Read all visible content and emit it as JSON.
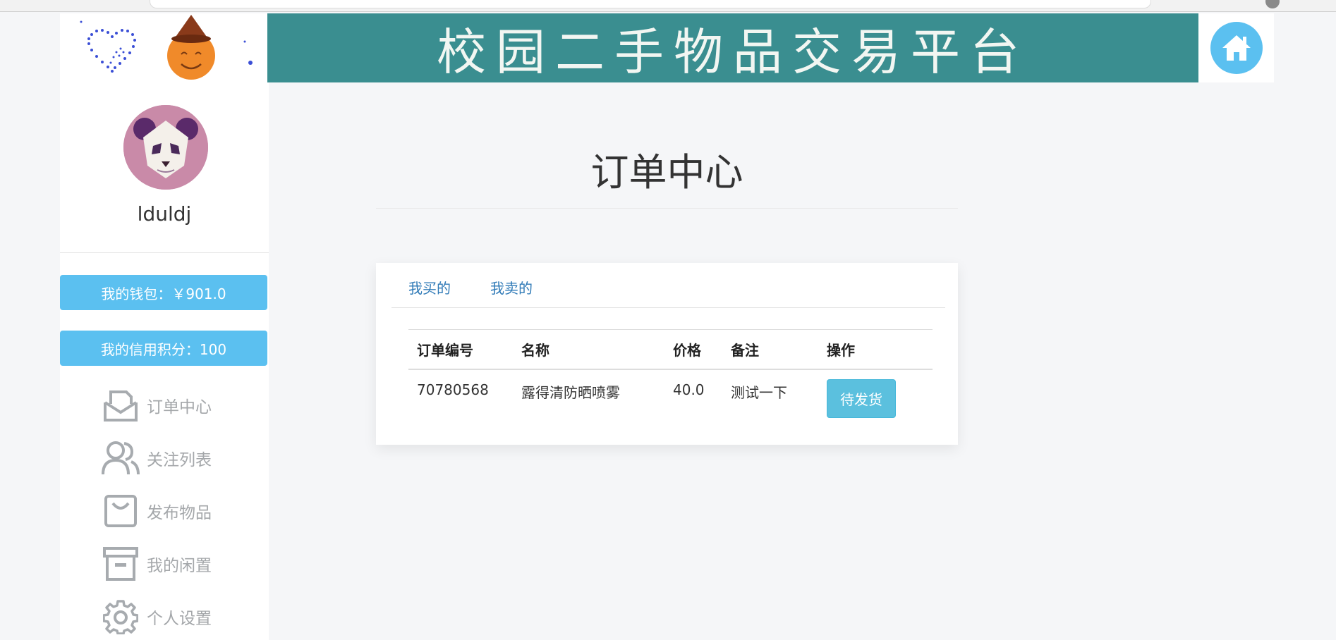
{
  "header": {
    "banner_title": "校园二手物品交易平台",
    "home_icon": "home-icon",
    "accent": "#3a8e90"
  },
  "sidebar": {
    "username": "lduldj",
    "wallet_label": "我的钱包：￥901.0",
    "credit_label": "我的信用积分：100",
    "items": [
      {
        "label": "订单中心",
        "icon": "mail-open-icon"
      },
      {
        "label": "关注列表",
        "icon": "users-icon"
      },
      {
        "label": "发布物品",
        "icon": "shopping-bag-icon"
      },
      {
        "label": "我的闲置",
        "icon": "archive-box-icon"
      },
      {
        "label": "个人设置",
        "icon": "gear-icon"
      }
    ],
    "pill_color": "#5bc0f0"
  },
  "main": {
    "title": "订单中心",
    "tabs": [
      {
        "label": "我买的"
      },
      {
        "label": "我卖的"
      }
    ],
    "table": {
      "headers": [
        "订单编号",
        "名称",
        "价格",
        "备注",
        "操作"
      ],
      "rows": [
        {
          "id": "70780568",
          "name": "露得清防晒喷雾",
          "price": "40.0",
          "note": "测试一下",
          "action": "待发货"
        }
      ]
    }
  }
}
